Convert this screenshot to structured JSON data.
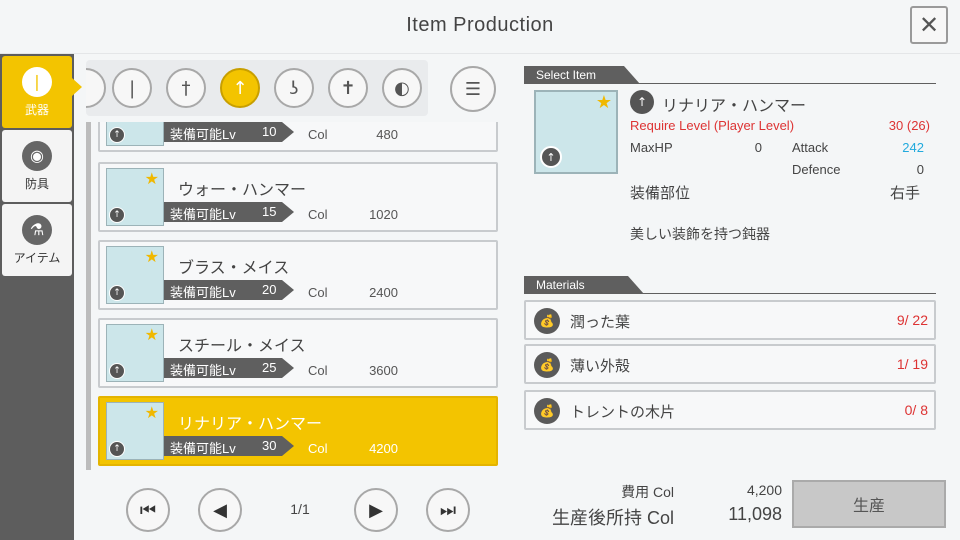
{
  "window": {
    "title": "Item Production"
  },
  "sidebar": {
    "items": [
      {
        "label": "武器"
      },
      {
        "label": "防具"
      },
      {
        "label": "アイテム"
      }
    ]
  },
  "list": {
    "items": [
      {
        "name": "",
        "lv_label": "装備可能Lv",
        "lv": "10",
        "col_label": "Col",
        "col": "480"
      },
      {
        "name": "ウォー・ハンマー",
        "lv_label": "装備可能Lv",
        "lv": "15",
        "col_label": "Col",
        "col": "1020"
      },
      {
        "name": "ブラス・メイス",
        "lv_label": "装備可能Lv",
        "lv": "20",
        "col_label": "Col",
        "col": "2400"
      },
      {
        "name": "スチール・メイス",
        "lv_label": "装備可能Lv",
        "lv": "25",
        "col_label": "Col",
        "col": "3600"
      },
      {
        "name": "リナリア・ハンマー",
        "lv_label": "装備可能Lv",
        "lv": "30",
        "col_label": "Col",
        "col": "4200"
      }
    ],
    "page": "1/1"
  },
  "detail": {
    "header": "Select Item",
    "name": "リナリア・ハンマー",
    "require_label": "Require Level (Player Level)",
    "require_value": "30 (26)",
    "maxhp_label": "MaxHP",
    "maxhp_value": "0",
    "attack_label": "Attack",
    "attack_value": "242",
    "defence_label": "Defence",
    "defence_value": "0",
    "slot_label": "装備部位",
    "slot_value": "右手",
    "description": "美しい装飾を持つ鈍器"
  },
  "materials": {
    "header": "Materials",
    "items": [
      {
        "name": "潤った葉",
        "count": "9/ 22"
      },
      {
        "name": "薄い外殻",
        "count": "1/ 19"
      },
      {
        "name": "トレントの木片",
        "count": "0/ 8"
      }
    ]
  },
  "cost": {
    "cost_label": "費用 Col",
    "cost_value": "4,200",
    "after_label": "生産後所持 Col",
    "after_value": "11,098"
  },
  "produce_label": "生産",
  "colors": {
    "accent": "#f3c400",
    "dark": "#5f5f5f",
    "red": "#dd3333",
    "blue": "#22aadd"
  }
}
